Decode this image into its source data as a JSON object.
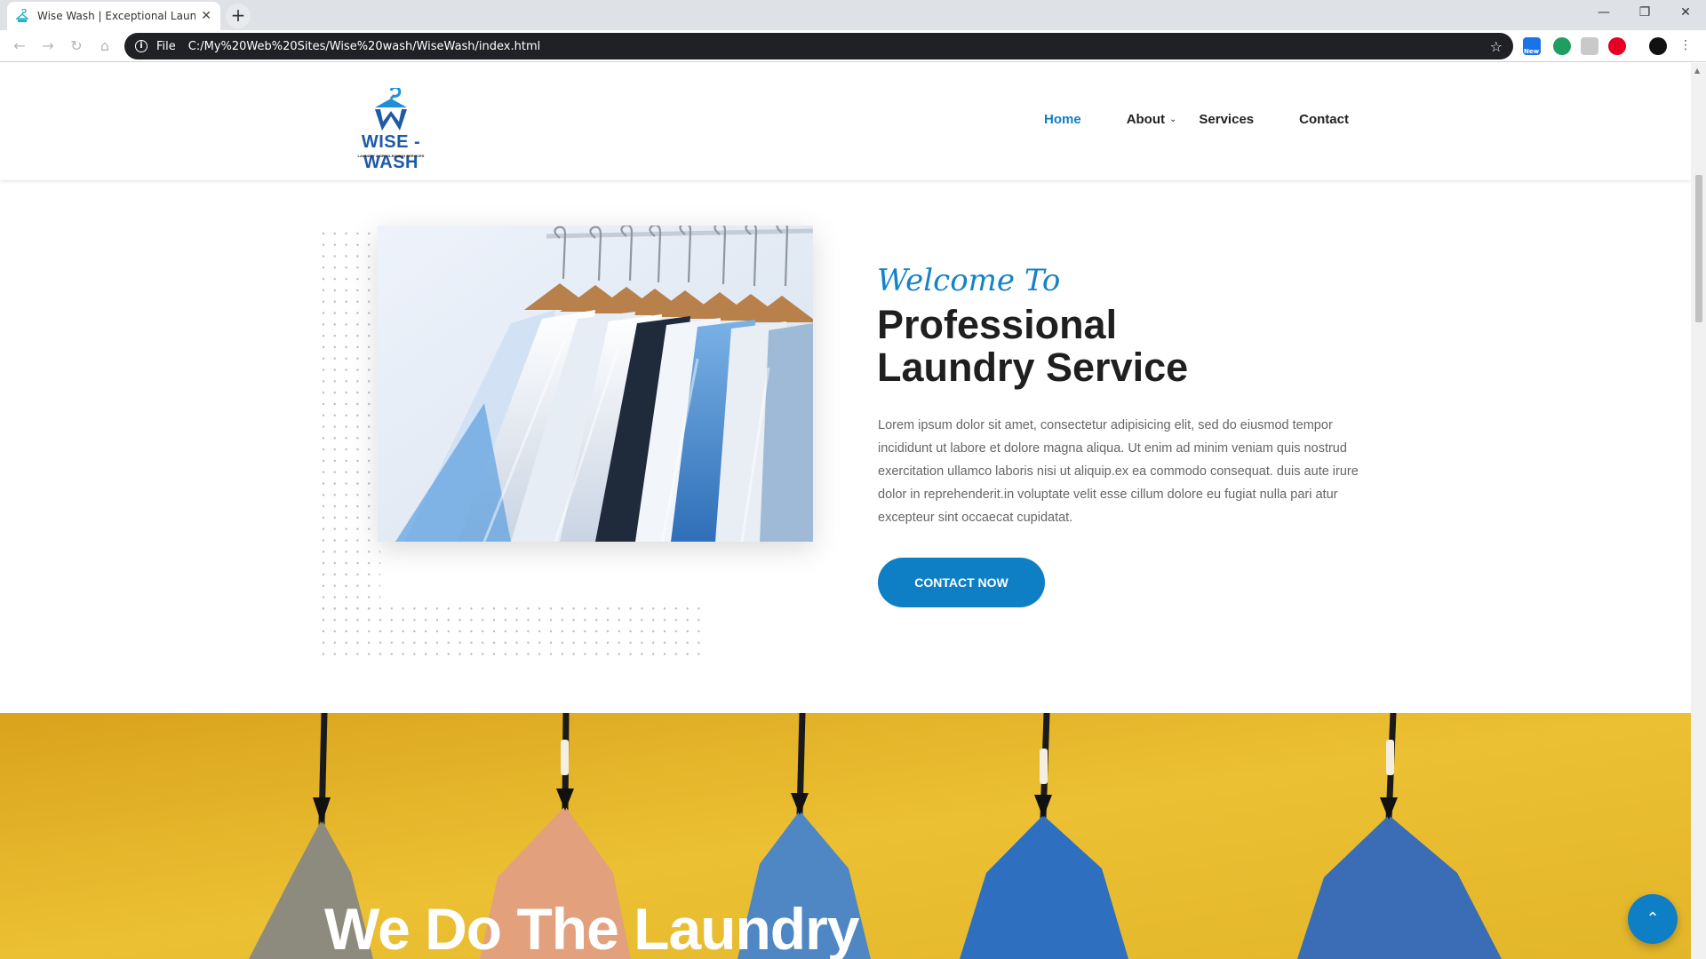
{
  "browser": {
    "tab_title": "Wise Wash | Exceptional Laundry",
    "tab_close": "✕",
    "new_tab": "+",
    "window_controls": [
      "—",
      "❐",
      "✕"
    ],
    "address_scheme": "File",
    "address_url": "C:/My%20Web%20Sites/Wise%20wash/WiseWash/index.html",
    "extension_badge": "New"
  },
  "site": {
    "logo_text": "WISE - WASH",
    "logo_sub": "LAUNDRY & DRYCLEANING SERVICES",
    "nav": [
      {
        "label": "Home",
        "active": true
      },
      {
        "label": "About",
        "active": false
      },
      {
        "label": "Services",
        "active": false
      },
      {
        "label": "Contact",
        "active": false
      }
    ],
    "brand_color": "#0e7fc5"
  },
  "hero": {
    "welcome": "Welcome To",
    "title_line1": "Professional",
    "title_line2": "Laundry Service",
    "body": "Lorem ipsum dolor sit amet, consectetur adipisicing elit, sed do eiusmod tempor incididunt ut labore et dolore magna aliqua. Ut enim ad minim veniam quis nostrud exercitation ullamco laboris nisi ut aliquip.ex ea commodo consequat. duis aute irure dolor in reprehenderit.in voluptate velit esse cillum dolore eu fugiat nulla pari atur excepteur sint occaecat cupidatat.",
    "cta": "CONTACT NOW"
  },
  "banner": {
    "title": "We Do The Laundry",
    "background_color": "#e6b324"
  },
  "icons": {
    "back": "arrow-left-icon",
    "forward": "arrow-right-icon",
    "reload": "reload-icon",
    "home": "home-icon",
    "info": "info-icon",
    "bookmark": "star-icon",
    "to_top": "chevron-up-icon"
  }
}
